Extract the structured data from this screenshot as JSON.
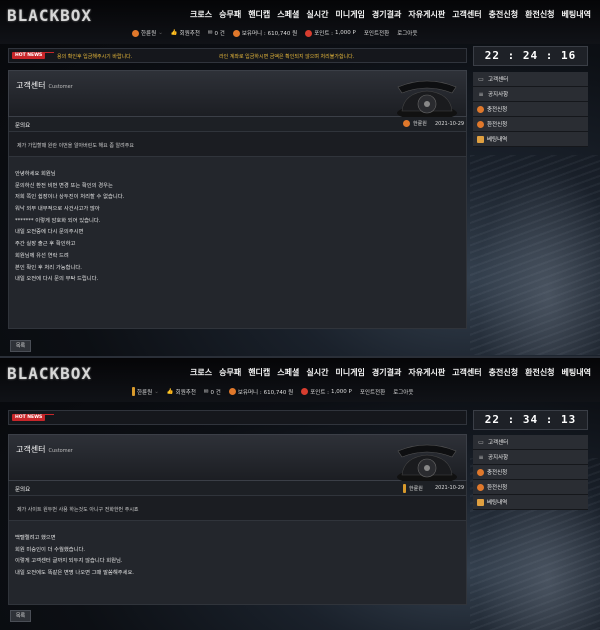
{
  "brand": {
    "logo": "BLACKBOX"
  },
  "nav": [
    "크로스",
    "승무패",
    "핸디캡",
    "스페셜",
    "실시간",
    "미니게임",
    "경기결과",
    "자유게시판",
    "고객센터",
    "충전신청",
    "환전신청",
    "베팅내역"
  ],
  "user": {
    "name": "한륜원",
    "recommend": "회원추천",
    "count": "0 건",
    "cash_label": "보유머니 :",
    "cash": "610,740 원",
    "point_label": "포인트 :",
    "point": "1,000 P",
    "point_exchange": "포인트전환",
    "logout": "로그아웃"
  },
  "news": {
    "badge": "HOT NEWS",
    "ticker_1": "용의 확인후 입금해주시기 바랍니다.",
    "ticker_2": "라인 계좌로 입금하시면 금액은 확인되지 않으며 처리불가합니다."
  },
  "screens": [
    {
      "clock": "22 : 24 : 16",
      "banner": {
        "title": "고객센터",
        "subtitle": "Customer"
      },
      "post": {
        "title": "문의요",
        "author": "한륜원",
        "date": "2021-10-29",
        "question": "제가 가입할때 원란 이번을 알아버린도 해요 좀 알려주요"
      },
      "answer": [
        "안녕하세요 회원님",
        "문의하신 환전 비번 변경 또는 확인의 경우는",
        "저희 쪽인 쉽장이나 상두진이 처리할 수 없습니다.",
        "워낙 외부 내부적으로 사건사고가 많아",
        "******* 이렇게 암호화 되어 있습니다.",
        "내일 오전중에 다시 문의주시면",
        "주간 실장 출근 후 확인하고",
        "회원님께 유선 연락 드려",
        "본인 확인 후 처리 가능합니다.",
        "내일 오전에 다시 문의 부탁 드립니다."
      ],
      "list_button": "목록"
    },
    {
      "clock": "22 : 34 : 13",
      "banner": {
        "title": "고객센터",
        "subtitle": "Customer"
      },
      "post": {
        "title": "문의요",
        "author": "한륜원",
        "date": "2021-10-29",
        "question": "제가 사이트 원두번 사용 하는것도 아니구 전화한번 주시죠"
      },
      "answer": [
        "백텔렐려고 했으면",
        "회원 미승인이 더 수월했습니다.",
        "이렇게 고객센터 글까지 되두지 않습니다 회원님.",
        "내일 오전에도 똑같은 변명 나오면 그때 말씀해주세요."
      ],
      "list_button": "목록"
    }
  ],
  "sidebar": [
    "고객센터",
    "공지사항",
    "충전신청",
    "환전신청",
    "베팅내역"
  ],
  "colors": {
    "accent_orange": "#e0782b",
    "news_red": "#c8262a",
    "ticker_yellow": "#e8b93b"
  }
}
